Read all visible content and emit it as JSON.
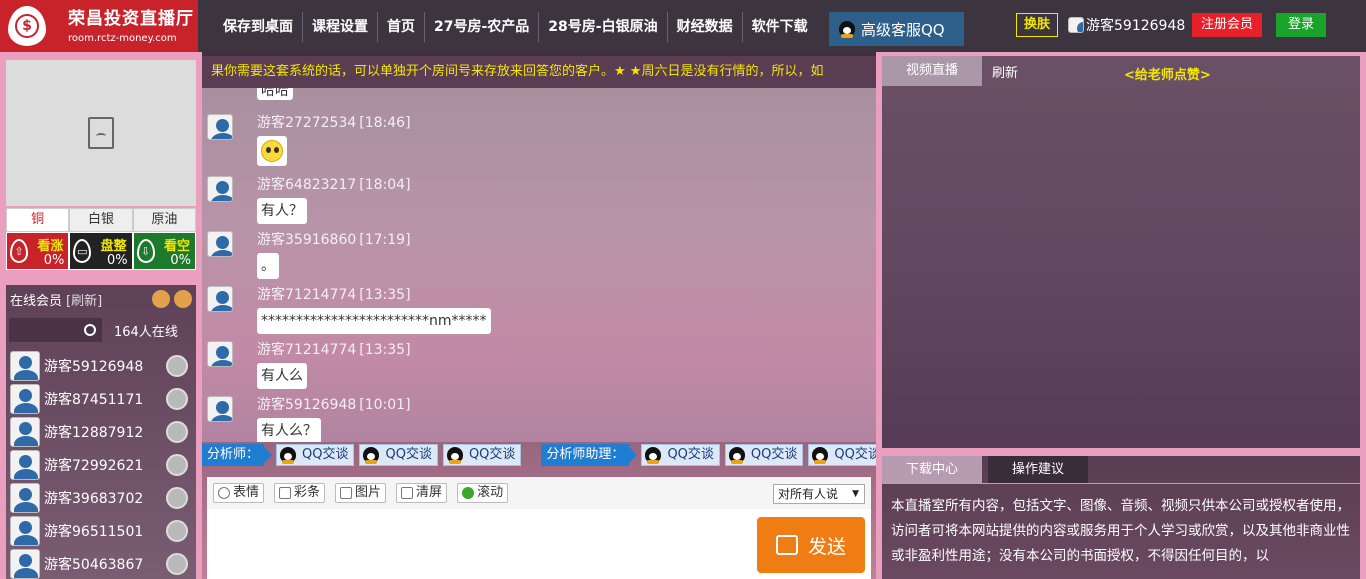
{
  "header": {
    "logo_title": "荣昌投资直播厅",
    "logo_url": "room.rctz-money.com",
    "nav": [
      "保存到桌面",
      "课程设置",
      "首页",
      "27号房-农产品",
      "28号房-白银原油",
      "财经数据",
      "软件下载"
    ],
    "qq_service": "高级客服QQ",
    "skin_button": "换肤",
    "current_user": "游客59126948",
    "register_button": "注册会员",
    "login_button": "登录"
  },
  "left": {
    "metal_tabs": [
      "铜",
      "白银",
      "原油"
    ],
    "sentiment": [
      {
        "label": "看涨",
        "value": "0%",
        "color": "#c8222b"
      },
      {
        "label": "盘整",
        "value": "0%",
        "color": "#222222"
      },
      {
        "label": "看空",
        "value": "0%",
        "color": "#1d7a2c"
      }
    ],
    "online_title": "在线会员",
    "refresh": "[刷新]",
    "online_count": "164人在线",
    "users": [
      "游客59126948",
      "游客87451171",
      "游客12887912",
      "游客72992621",
      "游客39683702",
      "游客96511501",
      "游客50463867"
    ]
  },
  "center": {
    "marquee": "果你需要这套系统的话，可以单独开个房间号来存放来回答您的客户。★ ★周六日是没有行情的，所以，如",
    "partial_top_message": "哈哈",
    "messages": [
      {
        "user": "游客27272534",
        "time": "[18:46]",
        "text": "",
        "emoji": true
      },
      {
        "user": "游客64823217",
        "time": "[18:04]",
        "text": "有人？",
        "emoji": false
      },
      {
        "user": "游客35916860",
        "time": "[17:19]",
        "text": "。",
        "emoji": false
      },
      {
        "user": "游客71214774",
        "time": "[13:35]",
        "text": "************************nm*****",
        "emoji": false
      },
      {
        "user": "游客71214774",
        "time": "[13:35]",
        "text": "有人么",
        "emoji": false
      },
      {
        "user": "游客59126948",
        "time": "[10:01]",
        "text": "有人么？",
        "emoji": false
      }
    ],
    "analyst_label": "分析师：",
    "assistant_label": "分析师助理：",
    "qq_chat": "QQ交谈",
    "tools": [
      "表情",
      "彩条",
      "图片",
      "清屏",
      "滚动"
    ],
    "send_to": "对所有人说",
    "send_button": "发送"
  },
  "right": {
    "video_tab": "视频直播",
    "refresh": "刷新",
    "like": "<给老师点赞>",
    "bottom_tabs": [
      "下载中心",
      "操作建议"
    ],
    "disclaimer": "本直播室所有内容，包括文字、图像、音频、视频只供本公司或授权者使用，访问者可将本网站提供的内容或服务用于个人学习或欣赏，以及其他非商业性或非盈利性用途；没有本公司的书面授权，不得因任何目的，以"
  }
}
